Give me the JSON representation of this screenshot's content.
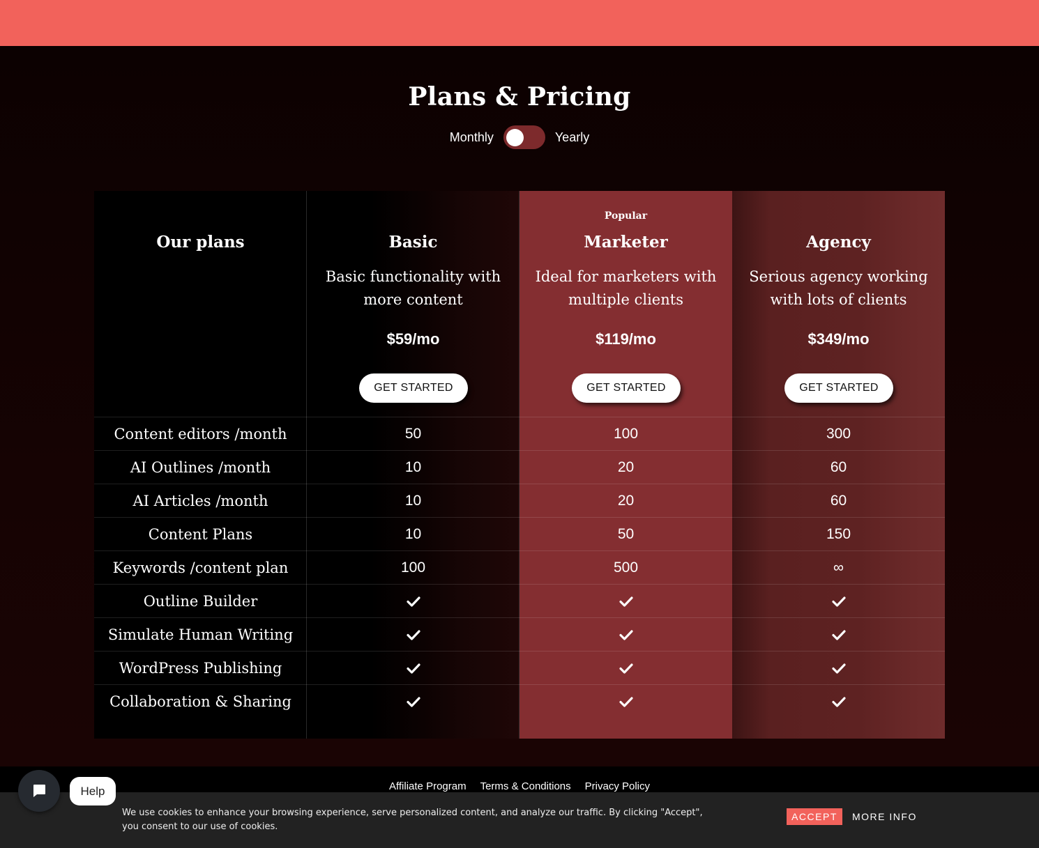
{
  "header": {
    "title": "Plans & Pricing"
  },
  "billing_toggle": {
    "left_label": "Monthly",
    "right_label": "Yearly",
    "state": "Monthly"
  },
  "table": {
    "header_label": "Our plans",
    "plans": [
      {
        "badge": "",
        "name": "Basic",
        "description": "Basic functionality with more content",
        "price": "$59/mo",
        "cta": "GET STARTED"
      },
      {
        "badge": "Popular",
        "name": "Marketer",
        "description": "Ideal for marketers with multiple clients",
        "price": "$119/mo",
        "cta": "GET STARTED"
      },
      {
        "badge": "",
        "name": "Agency",
        "description": "Serious agency working with lots of clients",
        "price": "$349/mo",
        "cta": "GET STARTED"
      }
    ],
    "features": [
      {
        "label": "Content editors /month",
        "values": [
          "50",
          "100",
          "300"
        ]
      },
      {
        "label": "AI Outlines /month",
        "values": [
          "10",
          "20",
          "60"
        ]
      },
      {
        "label": "AI Articles /month",
        "values": [
          "10",
          "20",
          "60"
        ]
      },
      {
        "label": "Content Plans",
        "values": [
          "10",
          "50",
          "150"
        ]
      },
      {
        "label": "Keywords /content plan",
        "values": [
          "100",
          "500",
          "∞"
        ]
      },
      {
        "label": "Outline Builder",
        "values": [
          "check",
          "check",
          "check"
        ]
      },
      {
        "label": "Simulate Human Writing",
        "values": [
          "check",
          "check",
          "check"
        ]
      },
      {
        "label": "WordPress Publishing",
        "values": [
          "check",
          "check",
          "check"
        ]
      },
      {
        "label": "Collaboration & Sharing",
        "values": [
          "check",
          "check",
          "check"
        ]
      }
    ]
  },
  "footer": {
    "links": [
      "Affiliate Program",
      "Terms & Conditions",
      "Privacy Policy"
    ]
  },
  "cookie_banner": {
    "text": "We use cookies to enhance your browsing experience, serve personalized content, and analyze our traffic. By clicking \"Accept\", you consent to our use of cookies.",
    "accept_label": "ACCEPT",
    "more_info_label": "MORE INFO"
  },
  "chat_widget": {
    "icon": "chat-bubble-icon",
    "help_label": "Help"
  },
  "colors": {
    "accent": "#f2625b",
    "popular_column": "#842e31",
    "background": "#120202"
  }
}
